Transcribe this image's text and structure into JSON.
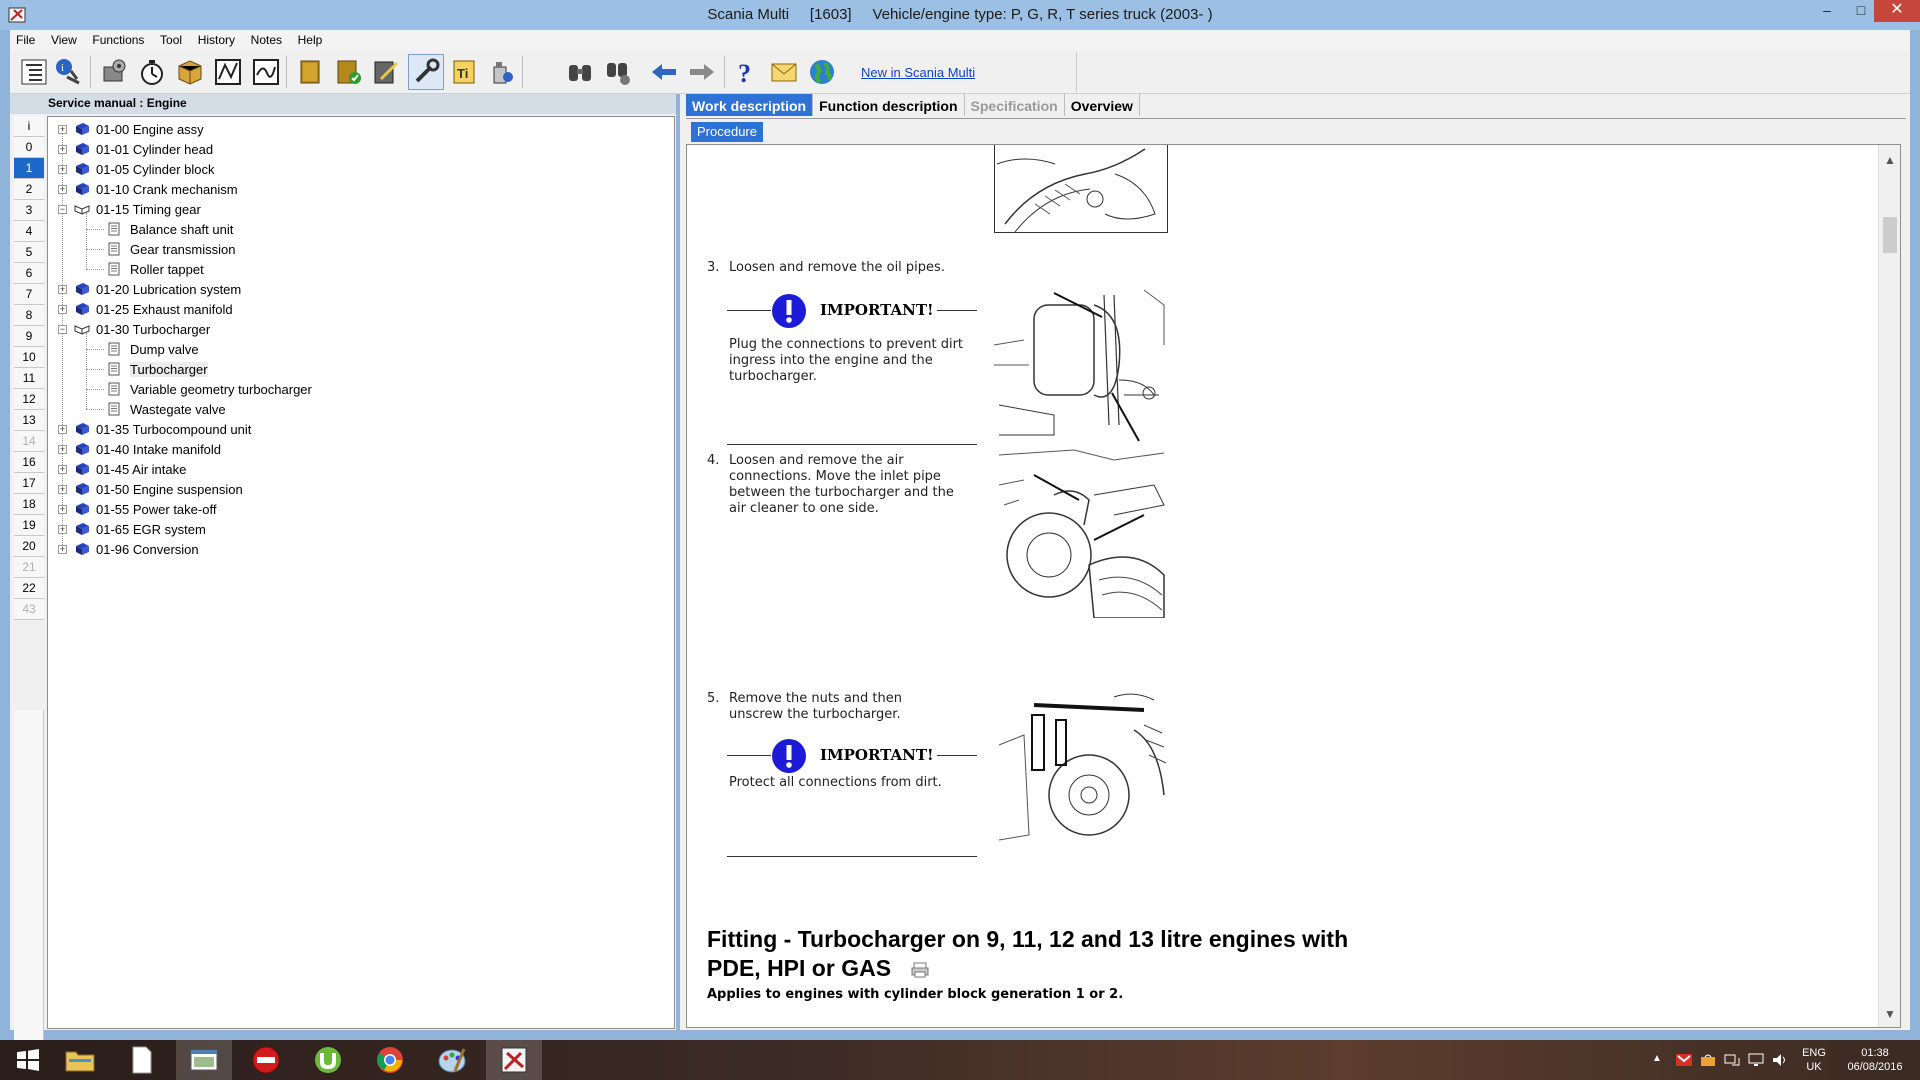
{
  "window": {
    "title": "Scania Multi     [1603]     Vehicle/engine type: P, G, R, T series truck (2003- )",
    "min_label": "–",
    "max_label": "□",
    "close_label": "✕"
  },
  "menu": [
    "File",
    "View",
    "Functions",
    "Tool",
    "History",
    "Notes",
    "Help"
  ],
  "toolbar": {
    "buttons": [
      "contents-icon",
      "info-icon",
      "engine-settings-icon",
      "stopwatch-icon",
      "parcel-icon",
      "diagram-icon",
      "chart-icon",
      "book-icon",
      "book-check-icon",
      "notepad-edit-icon",
      "wrench-icon",
      "text-tool-icon",
      "oil-can-icon",
      "binoculars-icon",
      "search-parts-icon",
      "back-arrow-icon",
      "forward-arrow-icon",
      "help-icon",
      "mail-icon",
      "globe-icon"
    ],
    "link_label": "New in Scania Multi"
  },
  "left_panel": {
    "header": "Service manual : Engine",
    "chapters": [
      {
        "label": "i",
        "state": "normal"
      },
      {
        "label": "0",
        "state": "normal"
      },
      {
        "label": "1",
        "state": "selected"
      },
      {
        "label": "2",
        "state": "normal"
      },
      {
        "label": "3",
        "state": "normal"
      },
      {
        "label": "4",
        "state": "normal"
      },
      {
        "label": "5",
        "state": "normal"
      },
      {
        "label": "6",
        "state": "normal"
      },
      {
        "label": "7",
        "state": "normal"
      },
      {
        "label": "8",
        "state": "normal"
      },
      {
        "label": "9",
        "state": "normal"
      },
      {
        "label": "10",
        "state": "normal"
      },
      {
        "label": "11",
        "state": "normal"
      },
      {
        "label": "12",
        "state": "normal"
      },
      {
        "label": "13",
        "state": "normal"
      },
      {
        "label": "14",
        "state": "disabled"
      },
      {
        "label": "16",
        "state": "normal"
      },
      {
        "label": "17",
        "state": "normal"
      },
      {
        "label": "18",
        "state": "normal"
      },
      {
        "label": "19",
        "state": "normal"
      },
      {
        "label": "20",
        "state": "normal"
      },
      {
        "label": "21",
        "state": "disabled"
      },
      {
        "label": "22",
        "state": "normal"
      },
      {
        "label": "43",
        "state": "disabled"
      }
    ],
    "tree": [
      {
        "label": "01-00 Engine assy",
        "level": 0,
        "expander": "+",
        "icon": "closed-book-icon"
      },
      {
        "label": "01-01 Cylinder head",
        "level": 0,
        "expander": "+",
        "icon": "closed-book-icon"
      },
      {
        "label": "01-05 Cylinder block",
        "level": 0,
        "expander": "+",
        "icon": "closed-book-icon"
      },
      {
        "label": "01-10 Crank mechanism",
        "level": 0,
        "expander": "+",
        "icon": "closed-book-icon"
      },
      {
        "label": "01-15 Timing gear",
        "level": 0,
        "expander": "−",
        "icon": "open-book-icon"
      },
      {
        "label": "Balance shaft unit",
        "level": 1,
        "icon": "page-icon"
      },
      {
        "label": "Gear transmission",
        "level": 1,
        "icon": "page-icon"
      },
      {
        "label": "Roller tappet",
        "level": 1,
        "icon": "page-icon"
      },
      {
        "label": "01-20 Lubrication system",
        "level": 0,
        "expander": "+",
        "icon": "closed-book-icon"
      },
      {
        "label": "01-25 Exhaust manifold",
        "level": 0,
        "expander": "+",
        "icon": "closed-book-icon"
      },
      {
        "label": "01-30 Turbocharger",
        "level": 0,
        "expander": "−",
        "icon": "open-book-icon"
      },
      {
        "label": "Dump valve",
        "level": 1,
        "icon": "page-icon"
      },
      {
        "label": "Turbocharger",
        "level": 1,
        "icon": "page-icon",
        "selected": true
      },
      {
        "label": "Variable geometry turbocharger",
        "level": 1,
        "icon": "page-icon"
      },
      {
        "label": "Wastegate valve",
        "level": 1,
        "icon": "page-icon"
      },
      {
        "label": "01-35 Turbocompound unit",
        "level": 0,
        "expander": "+",
        "icon": "closed-book-icon"
      },
      {
        "label": "01-40 Intake manifold",
        "level": 0,
        "expander": "+",
        "icon": "closed-book-icon"
      },
      {
        "label": "01-45 Air intake",
        "level": 0,
        "expander": "+",
        "icon": "closed-book-icon"
      },
      {
        "label": "01-50 Engine suspension",
        "level": 0,
        "expander": "+",
        "icon": "closed-book-icon"
      },
      {
        "label": "01-55 Power take-off",
        "level": 0,
        "expander": "+",
        "icon": "closed-book-icon"
      },
      {
        "label": "01-65 EGR system",
        "level": 0,
        "expander": "+",
        "icon": "closed-book-icon"
      },
      {
        "label": "01-96 Conversion",
        "level": 0,
        "expander": "+",
        "icon": "closed-book-icon"
      }
    ]
  },
  "right_panel": {
    "tabs": [
      {
        "label": "Work description",
        "state": "active"
      },
      {
        "label": "Function description",
        "state": "normal"
      },
      {
        "label": "Specification",
        "state": "disabled"
      },
      {
        "label": "Overview",
        "state": "normal"
      }
    ],
    "subtab": "Procedure",
    "steps": [
      {
        "number": "3.",
        "text": "Loosen and remove the oil pipes.",
        "important": {
          "label": "IMPORTANT!",
          "note": "Plug the connections to prevent dirt ingress into the engine and the turbocharger."
        }
      },
      {
        "number": "4.",
        "text": "Loosen and remove the air connections. Move the inlet pipe between the turbocharger and the air cleaner to one side."
      },
      {
        "number": "5.",
        "text": "Remove the nuts and then unscrew the turbocharger.",
        "important": {
          "label": "IMPORTANT!",
          "note": "Protect all connections from dirt."
        }
      }
    ],
    "section_title": "Fitting - Turbocharger on 9, 11, 12 and 13 litre engines with PDE, HPI or GAS",
    "section_subtitle": "Applies to engines with cylinder block generation 1 or 2."
  },
  "taskbar": {
    "apps": [
      "windows-start-icon",
      "file-explorer-icon",
      "blank-document-icon",
      "window-app-icon",
      "stop-app-icon",
      "utorrent-icon",
      "chrome-icon",
      "paint-icon",
      "scania-multi-icon"
    ],
    "lang_top": "ENG",
    "lang_bottom": "UK",
    "time": "01:38",
    "date": "06/08/2016"
  }
}
